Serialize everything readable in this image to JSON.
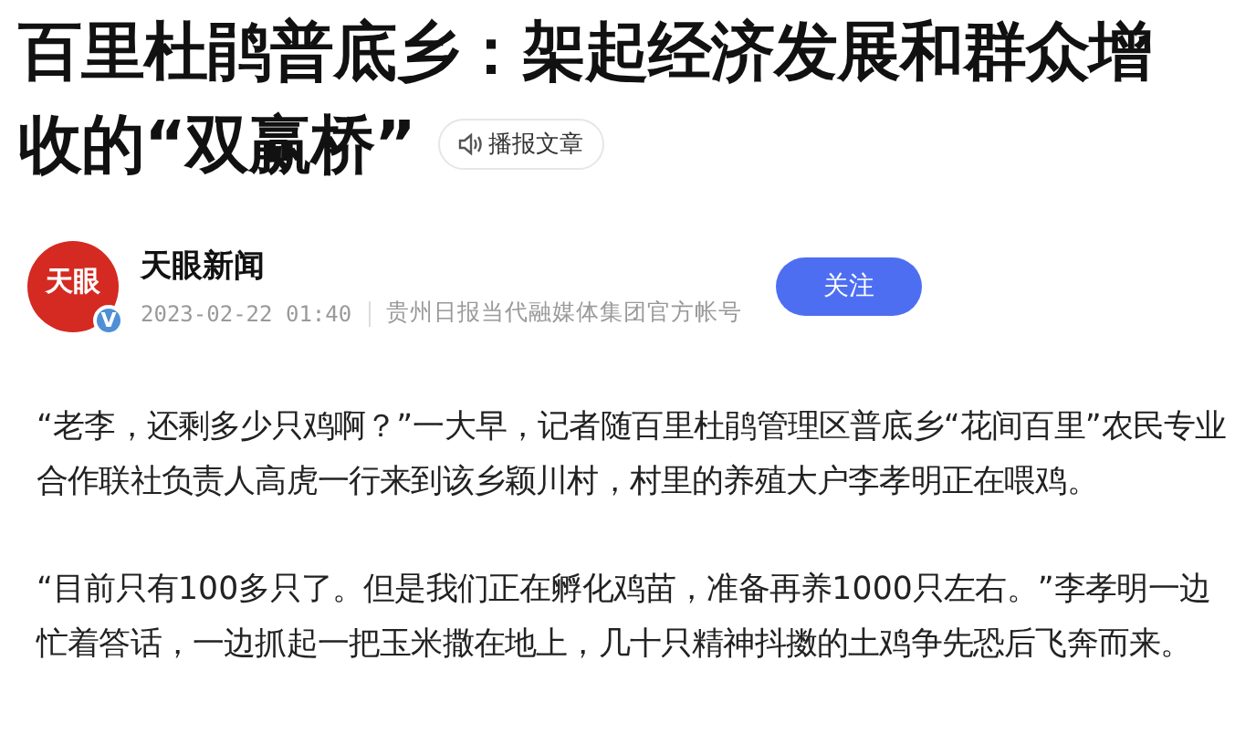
{
  "article": {
    "title_lines": [
      "百里杜鹃普底乡：架起经济发展和群众增",
      "收的“双赢桥”"
    ],
    "listen_button": {
      "label": "播报文章"
    },
    "author": {
      "avatar": {
        "logo_text": "天眼",
        "badge": "V"
      },
      "name": "天眼新闻",
      "date": "2023-02-22 01:40",
      "description": "贵州日报当代融媒体集团官方帐号",
      "follow_button": {
        "label": "关注"
      }
    },
    "paragraphs": [
      "“老李，还剩多少只鸡啊？”一大早，记者随百里杜鹃管理区普底乡“花间百里”农民专业合作联社负责人高虎一行来到该乡颖川村，村里的养殖大户李孝明正在喂鸡。",
      "“目前只有100多只了。但是我们正在孵化鸡苗，准备再养1000只左右。”李孝明一边忙着答话，一边抓起一把玉米撒在地上，几十只精神抖擞的土鸡争先恐后飞奔而来。"
    ]
  }
}
